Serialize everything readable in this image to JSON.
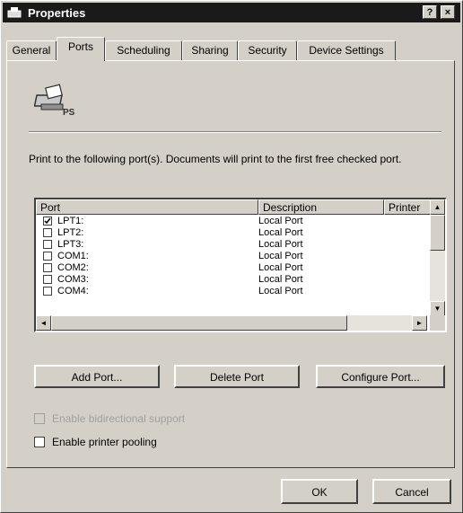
{
  "window": {
    "title": "Properties",
    "help_label": "?",
    "close_label": "×"
  },
  "tabs": [
    {
      "label": "General"
    },
    {
      "label": "Ports",
      "active": true
    },
    {
      "label": "Scheduling"
    },
    {
      "label": "Sharing"
    },
    {
      "label": "Security"
    },
    {
      "label": "Device Settings"
    }
  ],
  "printer": {
    "icon": "printer-icon",
    "badge": "PS"
  },
  "ports_panel": {
    "description": "Print to the following port(s). Documents will print to the first free checked port.",
    "columns": {
      "port": "Port",
      "description": "Description",
      "printer": "Printer"
    },
    "rows": [
      {
        "port": "LPT1:",
        "description": "Local Port",
        "checked": true
      },
      {
        "port": "LPT2:",
        "description": "Local Port",
        "checked": false
      },
      {
        "port": "LPT3:",
        "description": "Local Port",
        "checked": false
      },
      {
        "port": "COM1:",
        "description": "Local Port",
        "checked": false
      },
      {
        "port": "COM2:",
        "description": "Local Port",
        "checked": false
      },
      {
        "port": "COM3:",
        "description": "Local Port",
        "checked": false
      },
      {
        "port": "COM4:",
        "description": "Local Port",
        "checked": false
      }
    ],
    "scroll_arrows": {
      "up": "▲",
      "down": "▼",
      "left": "◄",
      "right": "►"
    }
  },
  "buttons": {
    "add_port": "Add Port...",
    "delete_port": "Delete Port",
    "configure_port": "Configure Port..."
  },
  "options": {
    "bidirectional": {
      "label": "Enable bidirectional support",
      "checked": false,
      "enabled": false
    },
    "pooling": {
      "label": "Enable printer pooling",
      "checked": false,
      "enabled": true
    }
  },
  "footer": {
    "ok": "OK",
    "cancel": "Cancel"
  }
}
